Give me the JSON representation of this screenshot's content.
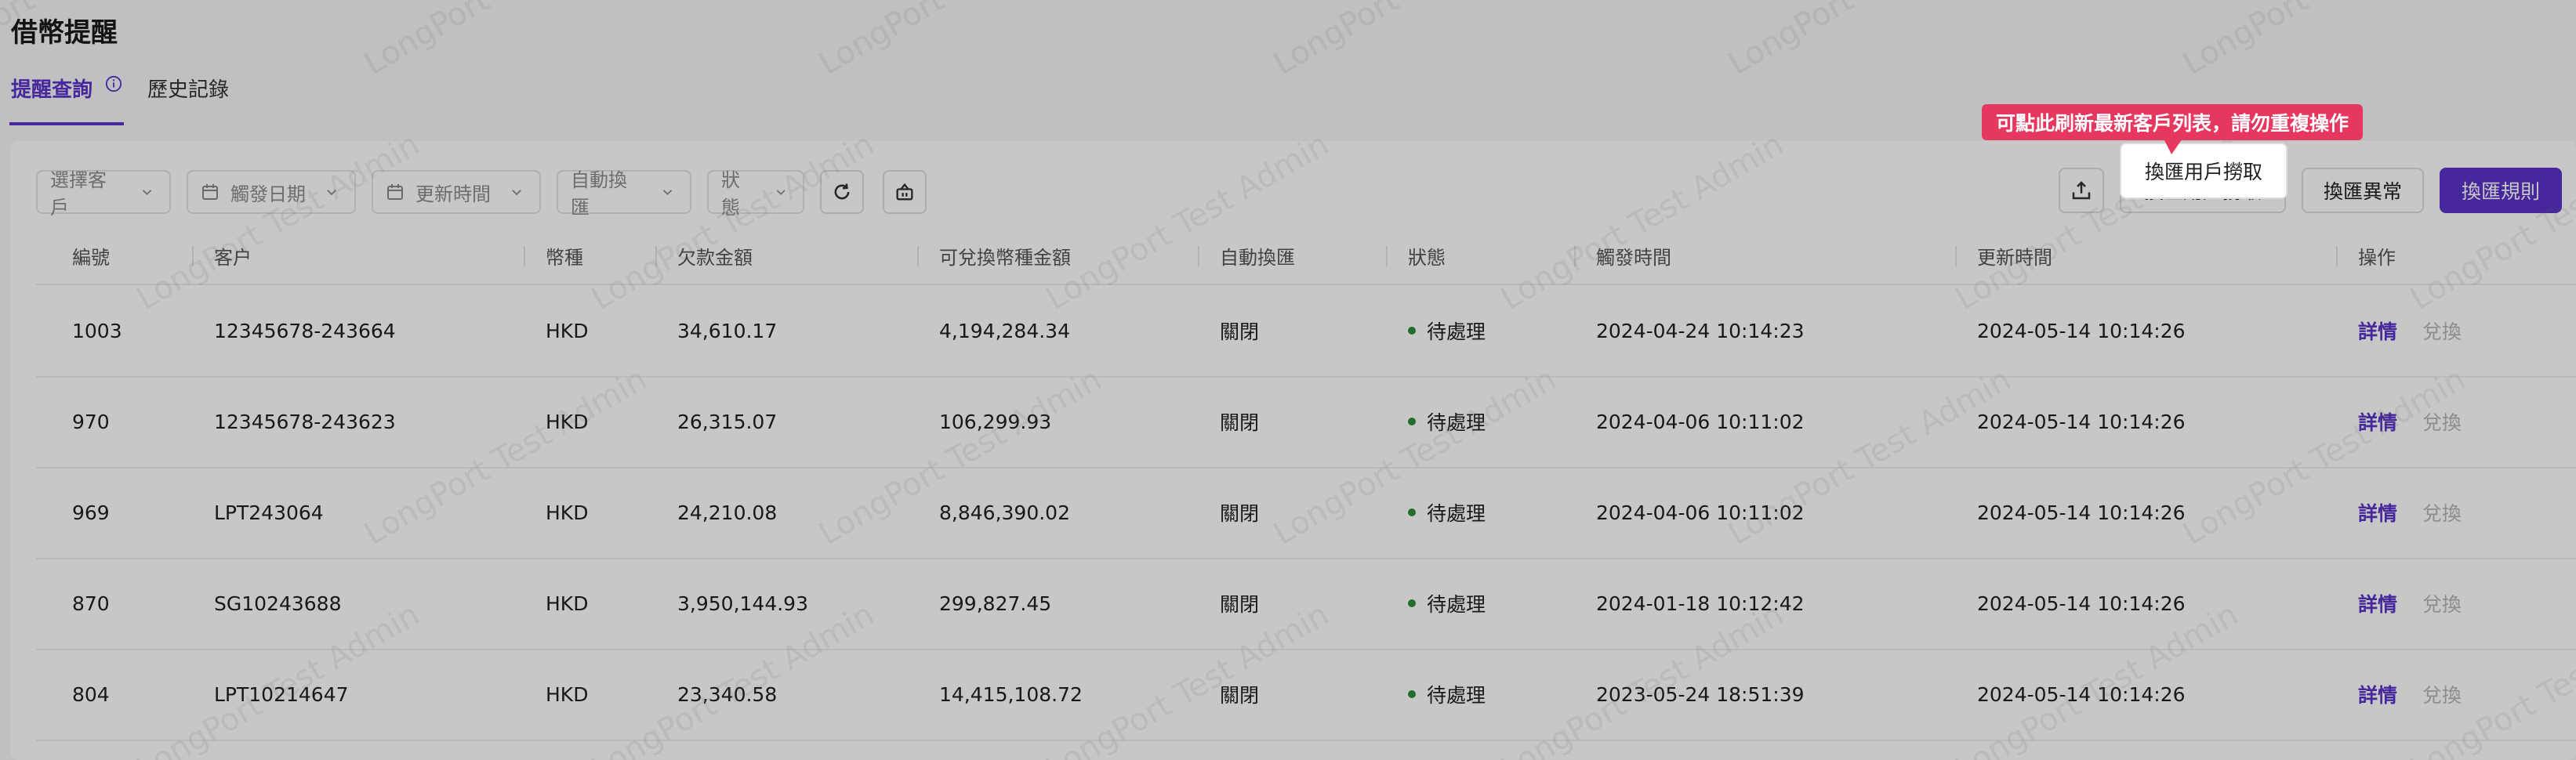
{
  "page": {
    "title": "借幣提醒"
  },
  "tabs": [
    {
      "label": "提醒查詢",
      "active": true
    },
    {
      "label": "歷史記錄",
      "active": false
    }
  ],
  "filters": {
    "customer": "選擇客戶",
    "trigger_date": "觸發日期",
    "update_time": "更新時間",
    "auto_exchange": "自動換匯",
    "status": "狀態"
  },
  "actions": {
    "fetch_users": "換匯用戶撈取",
    "exchange_exception": "換匯異常",
    "exchange_rules": "換匯規則"
  },
  "tooltip": {
    "text": "可點此刷新最新客戶列表，請勿重複操作"
  },
  "table": {
    "headers": [
      "編號",
      "客户",
      "幣種",
      "欠款金額",
      "可兌換幣種金額",
      "自動換匯",
      "狀態",
      "觸發時間",
      "更新時間",
      "操作"
    ],
    "rows": [
      {
        "id": "1003",
        "customer": "12345678-243664",
        "currency": "HKD",
        "debt": "34,610.17",
        "exchangeable": "4,194,284.34",
        "auto": "關閉",
        "status": "待處理",
        "trigger": "2024-04-24 10:14:23",
        "updated": "2024-05-14 10:14:26",
        "detail": "詳情",
        "exchange": "兌換"
      },
      {
        "id": "970",
        "customer": "12345678-243623",
        "currency": "HKD",
        "debt": "26,315.07",
        "exchangeable": "106,299.93",
        "auto": "關閉",
        "status": "待處理",
        "trigger": "2024-04-06 10:11:02",
        "updated": "2024-05-14 10:14:26",
        "detail": "詳情",
        "exchange": "兌換"
      },
      {
        "id": "969",
        "customer": "LPT243064",
        "currency": "HKD",
        "debt": "24,210.08",
        "exchangeable": "8,846,390.02",
        "auto": "關閉",
        "status": "待處理",
        "trigger": "2024-04-06 10:11:02",
        "updated": "2024-05-14 10:14:26",
        "detail": "詳情",
        "exchange": "兌換"
      },
      {
        "id": "870",
        "customer": "SG10243688",
        "currency": "HKD",
        "debt": "3,950,144.93",
        "exchangeable": "299,827.45",
        "auto": "關閉",
        "status": "待處理",
        "trigger": "2024-01-18 10:12:42",
        "updated": "2024-05-14 10:14:26",
        "detail": "詳情",
        "exchange": "兌換"
      },
      {
        "id": "804",
        "customer": "LPT10214647",
        "currency": "HKD",
        "debt": "23,340.58",
        "exchangeable": "14,415,108.72",
        "auto": "關閉",
        "status": "待處理",
        "trigger": "2023-05-24 18:51:39",
        "updated": "2024-05-14 10:14:26",
        "detail": "詳情",
        "exchange": "兌換"
      }
    ]
  },
  "watermark": "LongPort Test Admin",
  "colors": {
    "accent": "#5a34c8",
    "tooltip": "#e6385f",
    "status_dot": "#2e8b3a"
  }
}
